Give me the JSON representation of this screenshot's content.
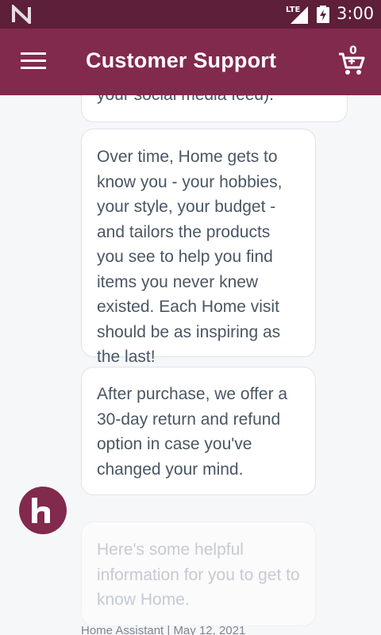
{
  "status_bar": {
    "network": "LTE",
    "time": "3:00"
  },
  "app_bar": {
    "title": "Customer Support",
    "cart_count": "0"
  },
  "messages": [
    {
      "text": "your social media feed)."
    },
    {
      "text": "Over time, Home gets to know you - your hobbies, your style, your budget - and tailors the products you see to help you find items you never knew existed. Each Home visit should be as inspiring as the last!"
    },
    {
      "text": "After purchase, we offer a 30-day return and refund option in case you've changed your mind."
    },
    {
      "text": "Here's some helpful information for you to get to know Home."
    }
  ],
  "message_meta": "Home Assistant | May 12, 2021",
  "colors": {
    "brand": "#82294e",
    "status_bar": "#5d1f3a",
    "bubble_text": "#4a5664"
  }
}
